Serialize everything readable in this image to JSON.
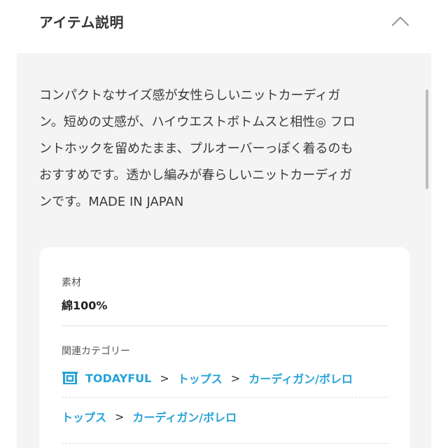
{
  "header": {
    "title": "アイテム説明"
  },
  "description": "コンパクトなサイズ感が女性らしいニットカーディガ\nン。短めの丈感が、ハイウエストボトムスと相性◎ フロ\nントホックを留めたまま、プルオーバーっぽく着るのも\nおすすめです。透かし編みが春らしいニットカーディガ\nンです。MADE IN JAPAN",
  "material": {
    "label": "素材",
    "value": "綿100%"
  },
  "categories": {
    "label": "関連カテゴリー",
    "row1": {
      "brand": "TODAYFUL",
      "sep1": ">",
      "cat1": "トップス",
      "sep2": ">",
      "cat2": "カーディガン/ボレロ"
    },
    "row2": {
      "cat1": "トップス",
      "sep1": ">",
      "cat2": "カーディガン/ボレロ"
    }
  },
  "colors": {
    "link": "#27a3d7",
    "panel_bg": "#f4f4f4"
  },
  "icons": {
    "collapse": "chevron-up-icon",
    "brand": "shop-icon"
  }
}
